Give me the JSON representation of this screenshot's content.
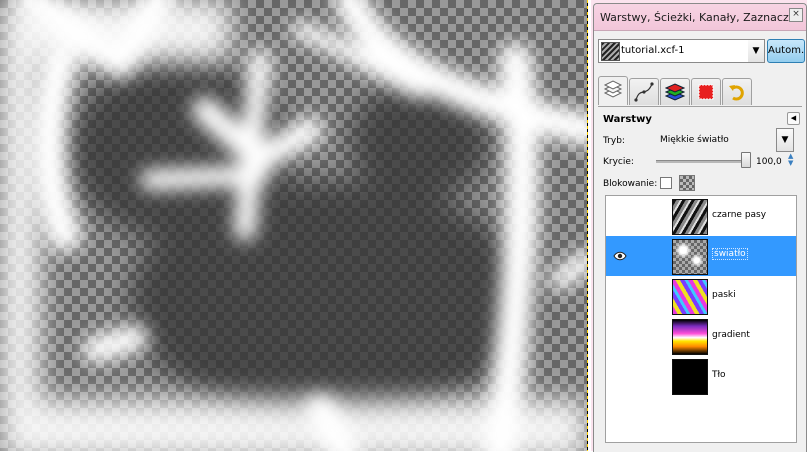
{
  "dock": {
    "title": "Warstwy, Ścieżki, Kanały, Zaznacz...",
    "image_selector": {
      "value": "tutorial.xcf-1",
      "auto_label": "Autom."
    },
    "tabs": [
      "layers-tab",
      "paths-tab",
      "channels-tab",
      "selection-tab",
      "undo-history-tab"
    ],
    "pane_title": "Warstwy",
    "mode": {
      "label": "Tryb:",
      "value": "Miękkie światło"
    },
    "opacity": {
      "label": "Krycie:",
      "value": "100,0",
      "fraction": 1.0
    },
    "lock": {
      "label": "Blokowanie:"
    },
    "layers": [
      {
        "name": "czarne pasy",
        "visible": false,
        "selected": false,
        "thumb": "diagonal-stripes"
      },
      {
        "name": "światło",
        "visible": true,
        "selected": true,
        "thumb": "light-pattern"
      },
      {
        "name": "paski",
        "visible": false,
        "selected": false,
        "thumb": "colored-stripes"
      },
      {
        "name": "gradient",
        "visible": false,
        "selected": false,
        "thumb": "gradient"
      },
      {
        "name": "Tło",
        "visible": false,
        "selected": false,
        "thumb": "black"
      }
    ]
  },
  "colors": {
    "accent": "#3399ff",
    "title_bar": "#f4cbdd",
    "auto_button": "#a9d8f4",
    "canvas_edge": "#ffd200"
  }
}
